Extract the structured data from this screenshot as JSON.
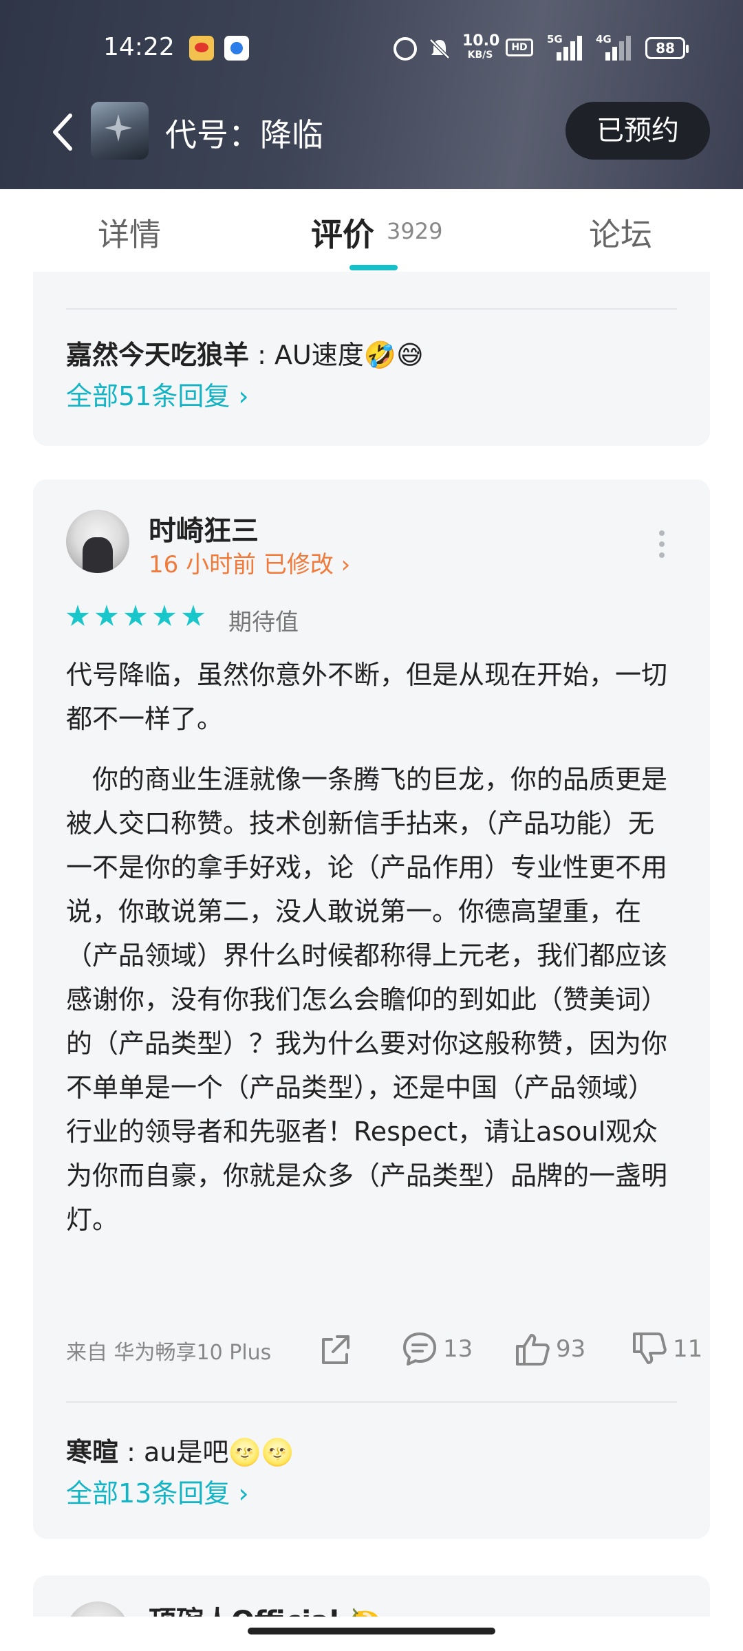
{
  "status_bar": {
    "time": "14:22",
    "net_speed": "10.0",
    "net_unit": "KB/S",
    "hd_label": "HD",
    "sig1_label": "5G",
    "sig2_label": "4G",
    "battery": "88"
  },
  "header": {
    "title": "代号：降临",
    "reserve_label": "已预约"
  },
  "tabs": {
    "detail": "详情",
    "review": "评价",
    "review_count": "3929",
    "forum": "论坛"
  },
  "card1": {
    "reply_author": "嘉然今天吃狼羊",
    "reply_text": " : AU速度🤣😅",
    "all_replies": "全部51条回复 ›"
  },
  "card2": {
    "author": "时崎狂三",
    "meta": "16 小时前 已修改 ›",
    "stars": 5,
    "rating_label": "期待值",
    "para1": "代号降临，虽然你意外不断，但是从现在开始，一切都不一样了。",
    "para2": "　你的商业生涯就像一条腾飞的巨龙，你的品质更是被人交口称赞。技术创新信手拈来，（产品功能）无一不是你的拿手好戏，论（产品作用）专业性更不用说，你敢说第二，没人敢说第一。你德高望重，在（产品领域）界什么时候都称得上元老，我们都应该感谢你，没有你我们怎么会瞻仰的到如此（赞美词）的（产品类型）？我为什么要对你这般称赞，因为你不单单是一个（产品类型），还是中国（产品领域）行业的领导者和先驱者！Respect，请让asoul观众为你而自豪，你就是众多（产品类型）品牌的一盏明灯。",
    "device": "来自 华为畅享10 Plus",
    "comment_count": "13",
    "like_count": "93",
    "dislike_count": "11",
    "reply_author": "寒暄",
    "reply_text": " : au是吧🌝🌝",
    "all_replies": "全部13条回复 ›"
  },
  "card3": {
    "author": "顶碗人Official 🍋"
  }
}
